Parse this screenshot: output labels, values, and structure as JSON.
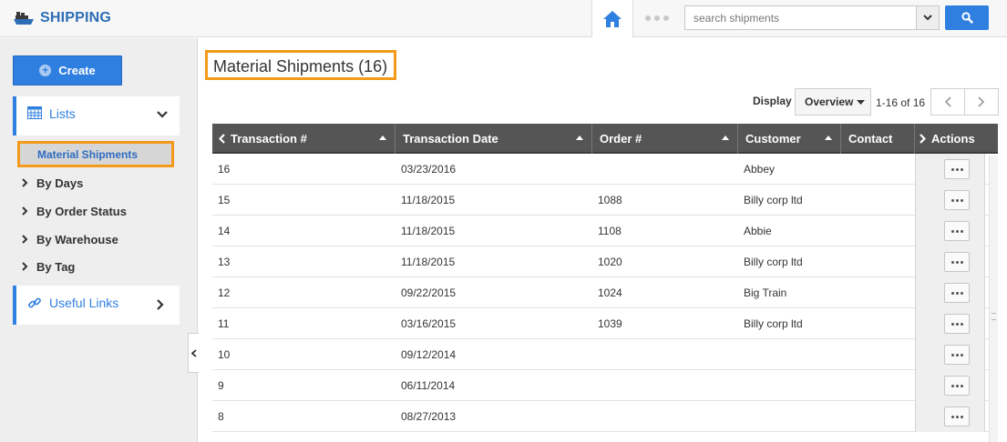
{
  "app": {
    "title": "SHIPPING",
    "brand_color": "#2d6db5",
    "accent": "#2f7fe0",
    "highlight": "#f39a1a"
  },
  "search": {
    "placeholder": "search shipments"
  },
  "sidebar": {
    "create_label": "Create",
    "lists_label": "Lists",
    "active_item": "Material Shipments",
    "items": [
      {
        "label": "By Days"
      },
      {
        "label": "By Order Status"
      },
      {
        "label": "By Warehouse"
      },
      {
        "label": "By Tag"
      }
    ],
    "useful_links_label": "Useful Links"
  },
  "main": {
    "title": "Material Shipments (16)",
    "display_label": "Display",
    "display_value": "Overview",
    "page_count": "1-16 of 16"
  },
  "table": {
    "columns": [
      "Transaction #",
      "Transaction Date",
      "Order #",
      "Customer",
      "Contact",
      "Actions"
    ],
    "rows": [
      {
        "transaction": "16",
        "date": "03/23/2016",
        "order": "",
        "customer": "Abbey",
        "contact": ""
      },
      {
        "transaction": "15",
        "date": "11/18/2015",
        "order": "1088",
        "customer": "Billy corp ltd",
        "contact": ""
      },
      {
        "transaction": "14",
        "date": "11/18/2015",
        "order": "1108",
        "customer": "Abbie",
        "contact": ""
      },
      {
        "transaction": "13",
        "date": "11/18/2015",
        "order": "1020",
        "customer": "Billy corp ltd",
        "contact": ""
      },
      {
        "transaction": "12",
        "date": "09/22/2015",
        "order": "1024",
        "customer": "Big Train",
        "contact": ""
      },
      {
        "transaction": "11",
        "date": "03/16/2015",
        "order": "1039",
        "customer": "Billy corp ltd",
        "contact": ""
      },
      {
        "transaction": "10",
        "date": "09/12/2014",
        "order": "",
        "customer": "",
        "contact": ""
      },
      {
        "transaction": "9",
        "date": "06/11/2014",
        "order": "",
        "customer": "",
        "contact": ""
      },
      {
        "transaction": "8",
        "date": "08/27/2013",
        "order": "",
        "customer": "",
        "contact": ""
      }
    ]
  }
}
